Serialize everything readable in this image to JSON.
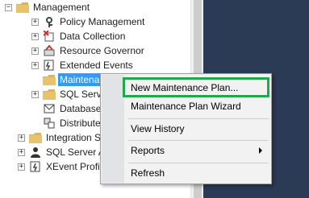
{
  "tree": {
    "items": [
      {
        "label": "Management",
        "expander": "−"
      },
      {
        "label": "Policy Management",
        "expander": "+"
      },
      {
        "label": "Data Collection",
        "expander": "+"
      },
      {
        "label": "Resource Governor",
        "expander": "+"
      },
      {
        "label": "Extended Events",
        "expander": "+"
      },
      {
        "label": "Maintenance Plans",
        "expander": ""
      },
      {
        "label": "SQL Server Logs",
        "expander": "+"
      },
      {
        "label": "Database Mail",
        "expander": ""
      },
      {
        "label": "Distributed Transaction Coordinator",
        "expander": ""
      },
      {
        "label": "Integration Services Catalogs",
        "expander": "+"
      },
      {
        "label": "SQL Server Agent",
        "expander": "+"
      },
      {
        "label": "XEvent Profiler",
        "expander": "+"
      }
    ]
  },
  "context_menu": {
    "items": [
      {
        "label": "New Maintenance Plan..."
      },
      {
        "label": "Maintenance Plan Wizard"
      },
      {
        "label": "View History"
      },
      {
        "label": "Reports"
      },
      {
        "label": "Refresh"
      }
    ],
    "highlight_color": "#21a84a"
  },
  "colors": {
    "selection": "#3399ff",
    "dark_panel": "#2b3a55"
  }
}
